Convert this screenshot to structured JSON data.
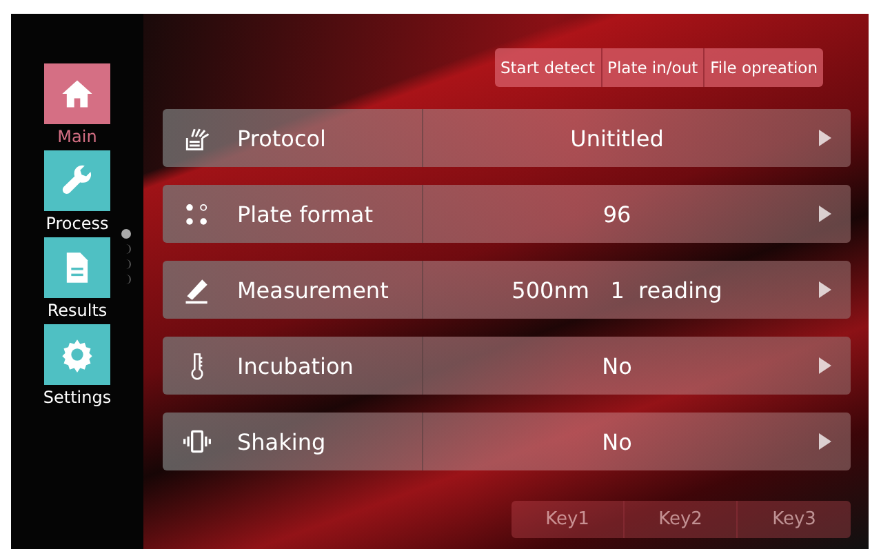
{
  "sidebar": {
    "items": [
      {
        "label": "Main",
        "selected": true
      },
      {
        "label": "Process",
        "selected": false
      },
      {
        "label": "Results",
        "selected": false
      },
      {
        "label": "Settings",
        "selected": false
      }
    ],
    "pages": [
      {
        "selected": true
      },
      {
        "selected": false
      },
      {
        "selected": false
      },
      {
        "selected": false
      }
    ]
  },
  "toolbar": [
    "Start detect",
    "Plate in/out",
    "File opreation"
  ],
  "settings": [
    {
      "label": "Protocol",
      "value": "Unititled"
    },
    {
      "label": "Plate format",
      "value": "96"
    },
    {
      "label": "Measurement",
      "value": "500nm   1  reading"
    },
    {
      "label": "Incubation",
      "value": "No"
    },
    {
      "label": "Shaking",
      "value": "No"
    }
  ],
  "keys": [
    "Key1",
    "Key2",
    "Key3"
  ]
}
